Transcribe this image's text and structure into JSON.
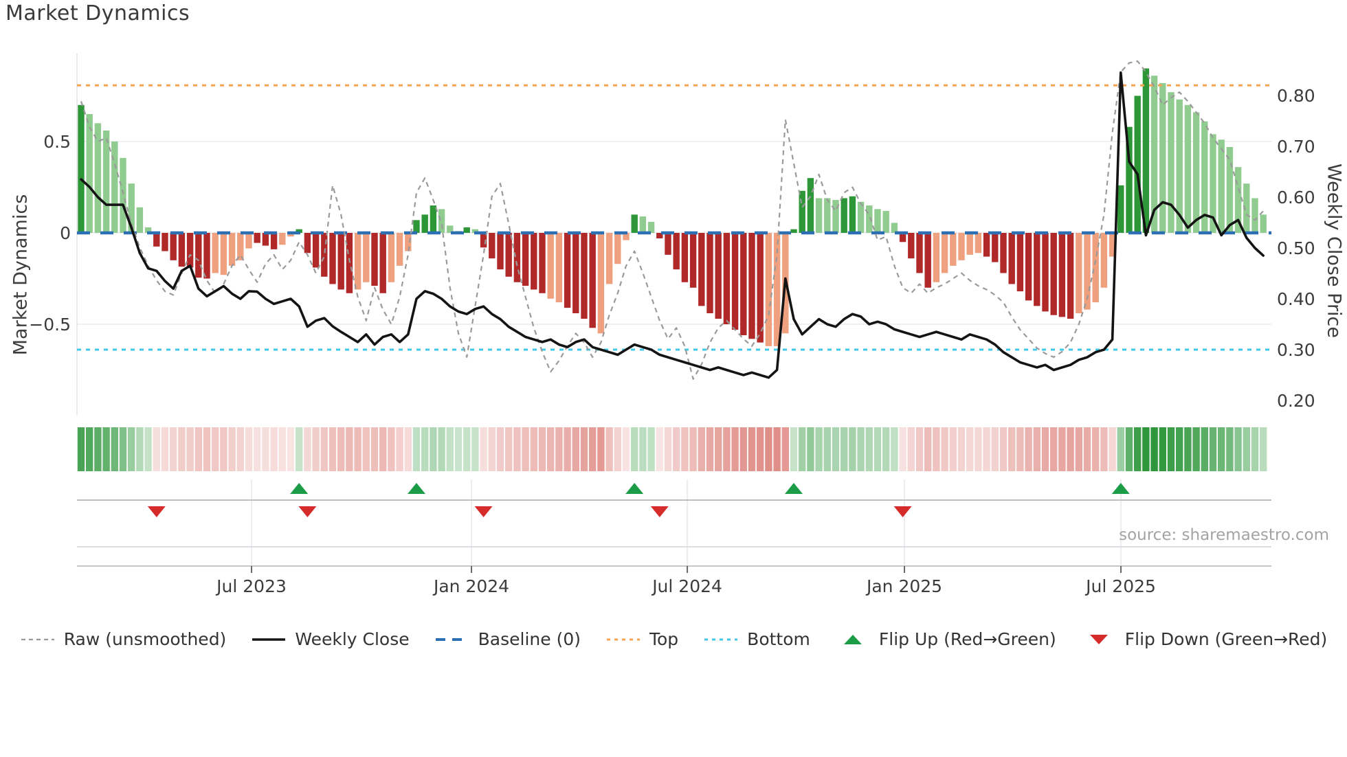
{
  "title": "Market Dynamics",
  "source": "source: sharemaestro.com",
  "legend": [
    {
      "label": "Raw (unsmoothed)",
      "swatch": "dashed-gray-line"
    },
    {
      "label": "Weekly Close",
      "swatch": "solid-black-line"
    },
    {
      "label": "Baseline (0)",
      "swatch": "dashed-blue-line"
    },
    {
      "label": "Top",
      "swatch": "dotted-orange-line"
    },
    {
      "label": "Bottom",
      "swatch": "dotted-cyan-line"
    },
    {
      "label": "Flip Up (Red→Green)",
      "swatch": "green-up-triangle"
    },
    {
      "label": "Flip Down (Green→Red)",
      "swatch": "red-down-triangle"
    }
  ],
  "colors": {
    "dark_green": "#2d9738",
    "light_green": "#90cb90",
    "dark_red": "#b02828",
    "salmon": "#efa07f",
    "baseline_blue": "#2d6fb3",
    "top_orange": "#f6a352",
    "bottom_cyan": "#42c8e8",
    "raw_gray": "#9a9a9a",
    "close_black": "#141414",
    "flip_up_green": "#1c9c46",
    "flip_down_red": "#d62b2b",
    "grid": "#ececf1",
    "axis_line": "#c6c6cb",
    "tick_text": "#3c3c3c"
  },
  "chart_data": {
    "type": "bar",
    "subtype": "weekly oscillator bars + price lines combo",
    "title": "Market Dynamics",
    "x_axis": {
      "unit": "week",
      "tick_labels": [
        "Jul 2023",
        "Jan 2024",
        "Jul 2024",
        "Jan 2025",
        "Jul 2025"
      ],
      "tick_weeks": [
        20.33,
        46.56,
        72.3,
        98.2,
        124.02
      ]
    },
    "left_axis": {
      "label": "Market Dynamics",
      "ticks": [
        0.5,
        0,
        -0.5
      ],
      "tick_display": [
        "0.5",
        "0",
        "−0.5"
      ],
      "range": [
        -1.0,
        0.98
      ]
    },
    "right_axis": {
      "label": "Weekly Close Price",
      "ticks": [
        0.8,
        0.7,
        0.6,
        0.5,
        0.4,
        0.3,
        0.2
      ],
      "tick_display": [
        "0.80",
        "0.70",
        "0.60",
        "0.50",
        "0.40",
        "0.30",
        "0.20"
      ],
      "range": [
        0.17,
        0.88
      ]
    },
    "levels": {
      "baseline": 0,
      "top_price": 0.82,
      "bottom_price": 0.3
    },
    "legend_position": "bottom center",
    "grid": "horizontal only",
    "flip_up_weeks": [
      26,
      40,
      66,
      85,
      124
    ],
    "flip_down_weeks": [
      9,
      27,
      48,
      69,
      98
    ],
    "shade_overrides": {
      "17": "light",
      "21": "dark",
      "22": "dark",
      "23": "dark",
      "56": "light",
      "57": "light",
      "62": "light",
      "82": "light"
    },
    "series": {
      "oscillator": [
        0.7,
        0.65,
        0.6,
        0.56,
        0.5,
        0.41,
        0.27,
        0.14,
        0.03,
        -0.075,
        -0.1,
        -0.15,
        -0.185,
        -0.19,
        -0.245,
        -0.25,
        -0.22,
        -0.23,
        -0.18,
        -0.15,
        -0.085,
        -0.055,
        -0.07,
        -0.09,
        -0.065,
        -0.02,
        0.02,
        -0.11,
        -0.19,
        -0.24,
        -0.28,
        -0.31,
        -0.33,
        -0.31,
        -0.27,
        -0.29,
        -0.33,
        -0.27,
        -0.18,
        -0.1,
        0.07,
        0.1,
        0.15,
        0.13,
        0.04,
        0.01,
        0.03,
        0.02,
        -0.08,
        -0.14,
        -0.2,
        -0.24,
        -0.27,
        -0.29,
        -0.31,
        -0.33,
        -0.36,
        -0.38,
        -0.41,
        -0.44,
        -0.47,
        -0.52,
        -0.55,
        -0.28,
        -0.17,
        -0.04,
        0.1,
        0.09,
        0.06,
        -0.03,
        -0.12,
        -0.2,
        -0.27,
        -0.3,
        -0.4,
        -0.44,
        -0.47,
        -0.5,
        -0.53,
        -0.56,
        -0.58,
        -0.6,
        -0.62,
        -0.62,
        -0.55,
        0.02,
        0.23,
        0.3,
        0.19,
        0.19,
        0.18,
        0.19,
        0.2,
        0.17,
        0.15,
        0.13,
        0.12,
        0.055,
        -0.05,
        -0.14,
        -0.22,
        -0.3,
        -0.27,
        -0.22,
        -0.18,
        -0.15,
        -0.12,
        -0.11,
        -0.13,
        -0.16,
        -0.22,
        -0.28,
        -0.32,
        -0.37,
        -0.4,
        -0.43,
        -0.45,
        -0.46,
        -0.47,
        -0.44,
        -0.42,
        -0.38,
        -0.3,
        -0.13,
        0.26,
        0.58,
        0.75,
        0.9,
        0.86,
        0.82,
        0.77,
        0.73,
        0.7,
        0.66,
        0.61,
        0.54,
        0.51,
        0.47,
        0.36,
        0.27,
        0.19,
        0.1
      ],
      "raw_unsmoothed": [
        0.72,
        0.58,
        0.5,
        0.52,
        0.38,
        0.22,
        0.05,
        -0.08,
        -0.18,
        -0.26,
        -0.32,
        -0.34,
        -0.22,
        -0.12,
        -0.15,
        -0.26,
        -0.33,
        -0.28,
        -0.18,
        -0.12,
        -0.2,
        -0.27,
        -0.17,
        -0.12,
        -0.2,
        -0.15,
        -0.05,
        -0.12,
        -0.22,
        -0.13,
        0.26,
        0.1,
        -0.15,
        -0.35,
        -0.48,
        -0.3,
        -0.42,
        -0.5,
        -0.35,
        -0.12,
        0.22,
        0.3,
        0.18,
        0.05,
        -0.3,
        -0.55,
        -0.68,
        -0.4,
        -0.12,
        0.2,
        0.27,
        0.05,
        -0.18,
        -0.35,
        -0.52,
        -0.65,
        -0.76,
        -0.7,
        -0.62,
        -0.55,
        -0.6,
        -0.68,
        -0.6,
        -0.45,
        -0.33,
        -0.18,
        -0.1,
        -0.22,
        -0.35,
        -0.48,
        -0.58,
        -0.52,
        -0.62,
        -0.8,
        -0.72,
        -0.6,
        -0.52,
        -0.48,
        -0.53,
        -0.58,
        -0.62,
        -0.55,
        -0.45,
        -0.12,
        0.62,
        0.38,
        0.14,
        0.2,
        0.32,
        0.18,
        0.12,
        0.22,
        0.25,
        0.16,
        0.1,
        -0.04,
        -0.02,
        -0.18,
        -0.3,
        -0.33,
        -0.28,
        -0.33,
        -0.3,
        -0.28,
        -0.25,
        -0.22,
        -0.26,
        -0.29,
        -0.31,
        -0.34,
        -0.38,
        -0.46,
        -0.53,
        -0.58,
        -0.63,
        -0.66,
        -0.68,
        -0.65,
        -0.6,
        -0.5,
        -0.36,
        -0.15,
        0.1,
        0.55,
        0.88,
        0.93,
        0.94,
        0.88,
        0.8,
        0.7,
        0.74,
        0.77,
        0.72,
        0.66,
        0.6,
        0.52,
        0.46,
        0.4,
        0.25,
        0.1,
        0.07,
        0.12
      ],
      "weekly_close": [
        0.635,
        0.62,
        0.6,
        0.585,
        0.585,
        0.585,
        0.54,
        0.49,
        0.46,
        0.455,
        0.435,
        0.42,
        0.455,
        0.465,
        0.42,
        0.405,
        0.415,
        0.425,
        0.41,
        0.4,
        0.415,
        0.414,
        0.4,
        0.39,
        0.395,
        0.4,
        0.385,
        0.345,
        0.357,
        0.362,
        0.346,
        0.335,
        0.325,
        0.315,
        0.33,
        0.31,
        0.325,
        0.33,
        0.315,
        0.33,
        0.4,
        0.415,
        0.41,
        0.4,
        0.385,
        0.375,
        0.37,
        0.38,
        0.385,
        0.37,
        0.36,
        0.345,
        0.335,
        0.325,
        0.32,
        0.315,
        0.32,
        0.31,
        0.305,
        0.315,
        0.32,
        0.305,
        0.3,
        0.295,
        0.29,
        0.3,
        0.31,
        0.305,
        0.3,
        0.29,
        0.285,
        0.28,
        0.275,
        0.27,
        0.265,
        0.26,
        0.265,
        0.26,
        0.255,
        0.25,
        0.255,
        0.25,
        0.245,
        0.26,
        0.44,
        0.36,
        0.33,
        0.345,
        0.36,
        0.35,
        0.345,
        0.36,
        0.37,
        0.365,
        0.35,
        0.355,
        0.35,
        0.34,
        0.335,
        0.33,
        0.325,
        0.33,
        0.335,
        0.33,
        0.325,
        0.32,
        0.33,
        0.325,
        0.32,
        0.31,
        0.295,
        0.285,
        0.275,
        0.27,
        0.265,
        0.27,
        0.26,
        0.265,
        0.27,
        0.28,
        0.285,
        0.295,
        0.3,
        0.32,
        0.845,
        0.67,
        0.645,
        0.525,
        0.575,
        0.59,
        0.585,
        0.565,
        0.54,
        0.555,
        0.565,
        0.56,
        0.525,
        0.545,
        0.555,
        0.52,
        0.5,
        0.485
      ]
    }
  }
}
